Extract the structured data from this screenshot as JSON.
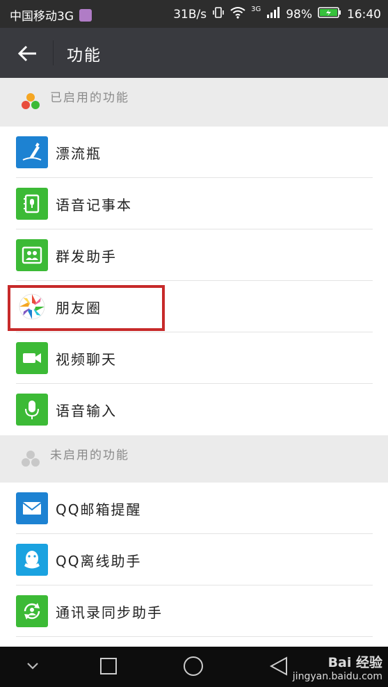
{
  "status_bar": {
    "carrier": "中国移动3G",
    "speed": "31B/s",
    "network": "3G",
    "battery": "98%",
    "time": "16:40"
  },
  "header": {
    "title": "功能"
  },
  "sections": {
    "enabled": {
      "label": "已启用的功能",
      "items": [
        {
          "label": "漂流瓶",
          "icon": "drift-bottle-icon",
          "color": "#1d82d2"
        },
        {
          "label": "语音记事本",
          "icon": "voice-notebook-icon",
          "color": "#3cba36"
        },
        {
          "label": "群发助手",
          "icon": "mass-send-icon",
          "color": "#3cba36"
        },
        {
          "label": "朋友圈",
          "icon": "moments-icon",
          "color": "#ffffff"
        },
        {
          "label": "视频聊天",
          "icon": "video-chat-icon",
          "color": "#3cba36"
        },
        {
          "label": "语音输入",
          "icon": "microphone-icon",
          "color": "#3cba36"
        }
      ]
    },
    "disabled": {
      "label": "未启用的功能",
      "items": [
        {
          "label": "QQ邮箱提醒",
          "icon": "mail-icon",
          "color": "#1d82d2"
        },
        {
          "label": "QQ离线助手",
          "icon": "qq-penguin-icon",
          "color": "#1aa2e0"
        },
        {
          "label": "通讯录同步助手",
          "icon": "sync-contacts-icon",
          "color": "#3cba36"
        }
      ]
    }
  },
  "watermark": {
    "brand": "Bai 经验",
    "url": "jingyan.baidu.com"
  },
  "highlight_color": "#c72a2a"
}
